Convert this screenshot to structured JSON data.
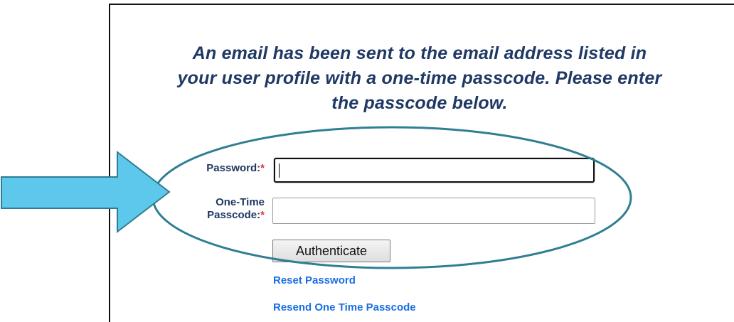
{
  "colors": {
    "message_text": "#1f3864",
    "label_text": "#1f3864",
    "required_asterisk": "#e0302e",
    "link_text": "#1a6fe0",
    "arrow_fill": "#5ec8ec",
    "arrow_stroke": "#2f7d92",
    "ellipse_stroke": "#2f7f92"
  },
  "message": {
    "line1": "An email has been sent to the email address listed in",
    "line2": "your user profile with a one-time passcode. Please enter",
    "line3": "the passcode below."
  },
  "form": {
    "password_label": "Password:",
    "otp_label_line1": "One-Time",
    "otp_label_line2": "Passcode:",
    "required_mark": "*",
    "password_value": "",
    "otp_value": "",
    "authenticate_label": "Authenticate"
  },
  "links": {
    "reset_password": "Reset Password",
    "resend_otp": "Resend One Time Passcode"
  },
  "annotations": {
    "arrow_icon": "right-arrow-icon",
    "highlight_shape": "ellipse-highlight"
  }
}
